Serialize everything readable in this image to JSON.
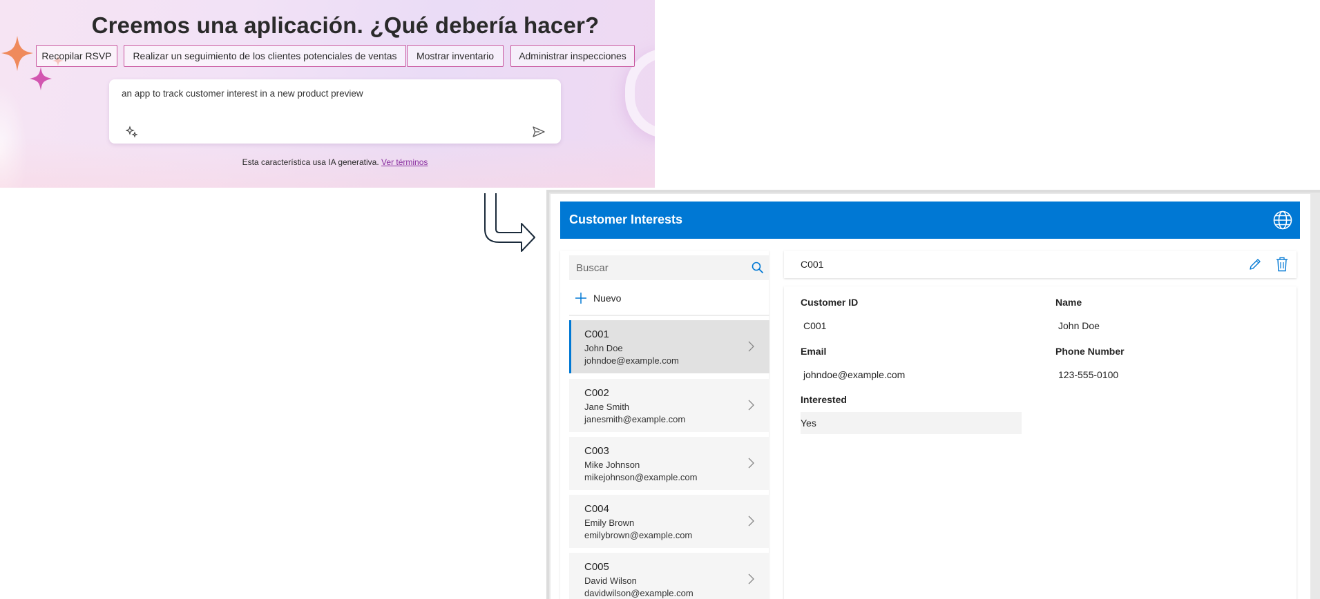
{
  "prompt": {
    "headline": "Creemos una aplicación. ¿Qué debería hacer?",
    "suggestions": [
      "Recopilar RSVP",
      "Realizar un seguimiento de los clientes potenciales de ventas",
      "Mostrar inventario",
      "Administrar inspecciones"
    ],
    "input_value": "an app to track customer interest in a new product preview",
    "disclaimer_text": "Esta característica usa IA generativa.",
    "terms_link": "Ver términos"
  },
  "app": {
    "title": "Customer Interests",
    "header_color": "#0078d4",
    "search_placeholder": "Buscar",
    "new_label": "Nuevo",
    "list": [
      {
        "id": "C001",
        "name": "John Doe",
        "email": "johndoe@example.com",
        "selected": true
      },
      {
        "id": "C002",
        "name": "Jane Smith",
        "email": "janesmith@example.com",
        "selected": false
      },
      {
        "id": "C003",
        "name": "Mike Johnson",
        "email": "mikejohnson@example.com",
        "selected": false
      },
      {
        "id": "C004",
        "name": "Emily Brown",
        "email": "emilybrown@example.com",
        "selected": false
      },
      {
        "id": "C005",
        "name": "David Wilson",
        "email": "davidwilson@example.com",
        "selected": false
      }
    ],
    "record": {
      "title": "C001",
      "labels": {
        "customer_id": "Customer ID",
        "name": "Name",
        "email": "Email",
        "phone": "Phone Number",
        "interested": "Interested"
      },
      "values": {
        "customer_id": "C001",
        "name": "John Doe",
        "email": "johndoe@example.com",
        "phone": "123-555-0100",
        "interested": "Yes"
      }
    }
  }
}
